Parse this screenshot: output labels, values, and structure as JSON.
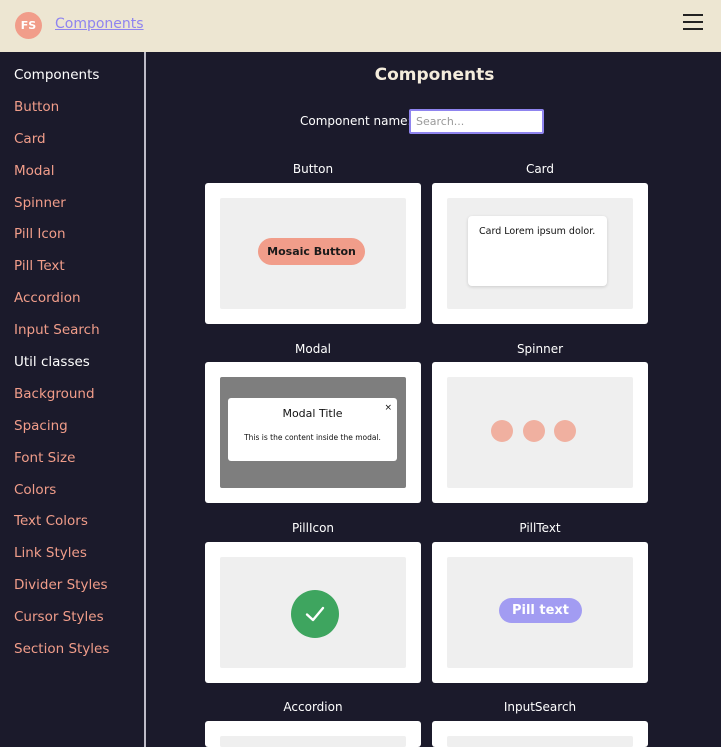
{
  "header": {
    "avatar_initials": "FS",
    "brand_link": "Components"
  },
  "sidebar": {
    "items": [
      {
        "label": "Components",
        "heading": true
      },
      {
        "label": "Button"
      },
      {
        "label": "Card"
      },
      {
        "label": "Modal"
      },
      {
        "label": "Spinner"
      },
      {
        "label": "Pill Icon"
      },
      {
        "label": "Pill Text"
      },
      {
        "label": "Accordion"
      },
      {
        "label": "Input Search"
      },
      {
        "label": "Util classes",
        "heading": true
      },
      {
        "label": "Background"
      },
      {
        "label": "Spacing"
      },
      {
        "label": "Font Size"
      },
      {
        "label": "Colors"
      },
      {
        "label": "Text Colors"
      },
      {
        "label": "Link Styles"
      },
      {
        "label": "Divider Styles"
      },
      {
        "label": "Cursor Styles"
      },
      {
        "label": "Section Styles"
      }
    ]
  },
  "main": {
    "title": "Components",
    "search": {
      "label": "Component name:",
      "placeholder": "Search..."
    },
    "cards": [
      {
        "label": "Button",
        "button_text": "Mosaic Button"
      },
      {
        "label": "Card",
        "card_text": "Card Lorem ipsum dolor."
      },
      {
        "label": "Modal",
        "modal_title": "Modal Title",
        "modal_close": "×",
        "modal_content": "This is the content inside the modal."
      },
      {
        "label": "Spinner"
      },
      {
        "label": "PillIcon",
        "icon": "check-icon"
      },
      {
        "label": "PillText",
        "pill_text": "Pill text"
      },
      {
        "label": "Accordion"
      },
      {
        "label": "InputSearch"
      }
    ]
  },
  "colors": {
    "background": "#1b1a2b",
    "header": "#ede6d2",
    "accent": "#f19d8a",
    "link": "#8f84ef",
    "pill_icon": "#3ea55f",
    "pill_text": "#a29cf2"
  }
}
